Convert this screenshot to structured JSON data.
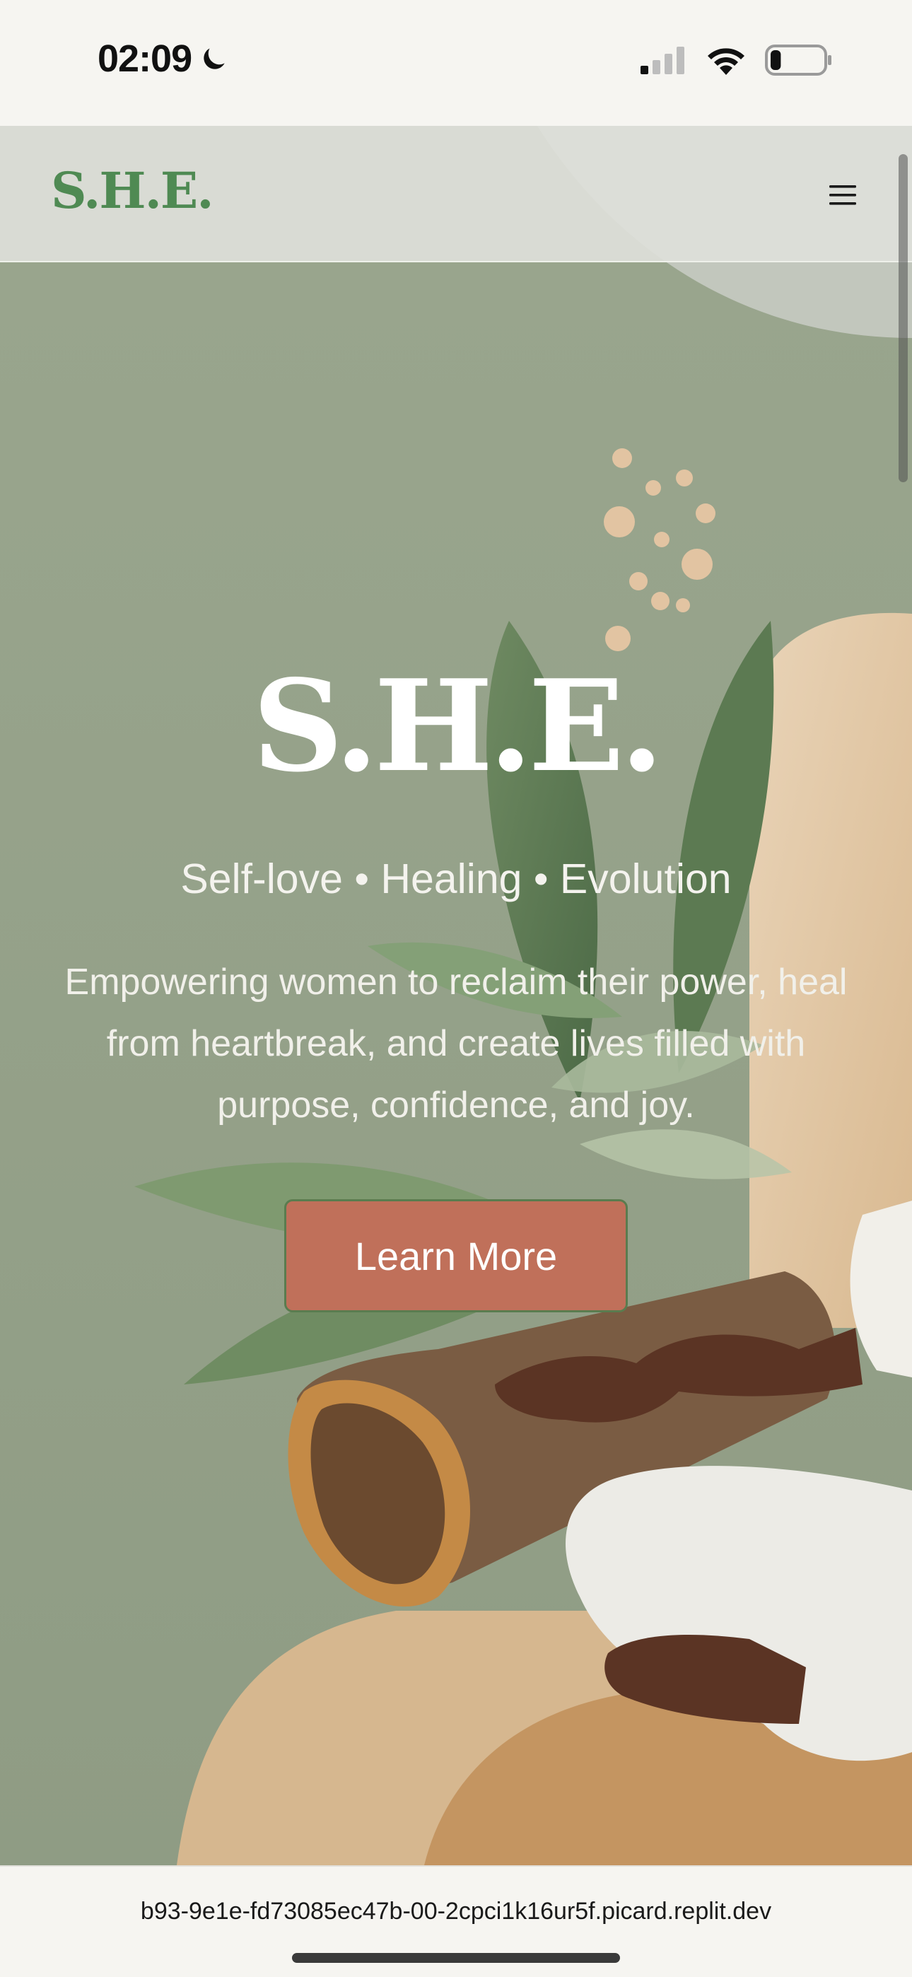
{
  "status_bar": {
    "time": "02:09",
    "moon_icon": "moon-icon",
    "signal_icon": "cellular-signal-icon",
    "wifi_icon": "wifi-icon",
    "battery_icon": "battery-icon",
    "battery_level": 0.2
  },
  "header": {
    "logo": "S.H.E.",
    "menu_icon": "hamburger-menu-icon"
  },
  "hero": {
    "title": "S.H.E.",
    "tagline": "Self-love • Healing • Evolution",
    "description": "Empowering women to reclaim their power, heal from heartbreak, and create lives filled with purpose, confidence, and joy.",
    "cta_label": "Learn More"
  },
  "browser": {
    "url": "b93-9e1e-fd73085ec47b-00-2cpci1k16ur5f.picard.replit.dev"
  },
  "colors": {
    "brand_green": "#4f8a53",
    "cta_terracotta": "#c0705a",
    "hero_sage": "#97a48a"
  }
}
